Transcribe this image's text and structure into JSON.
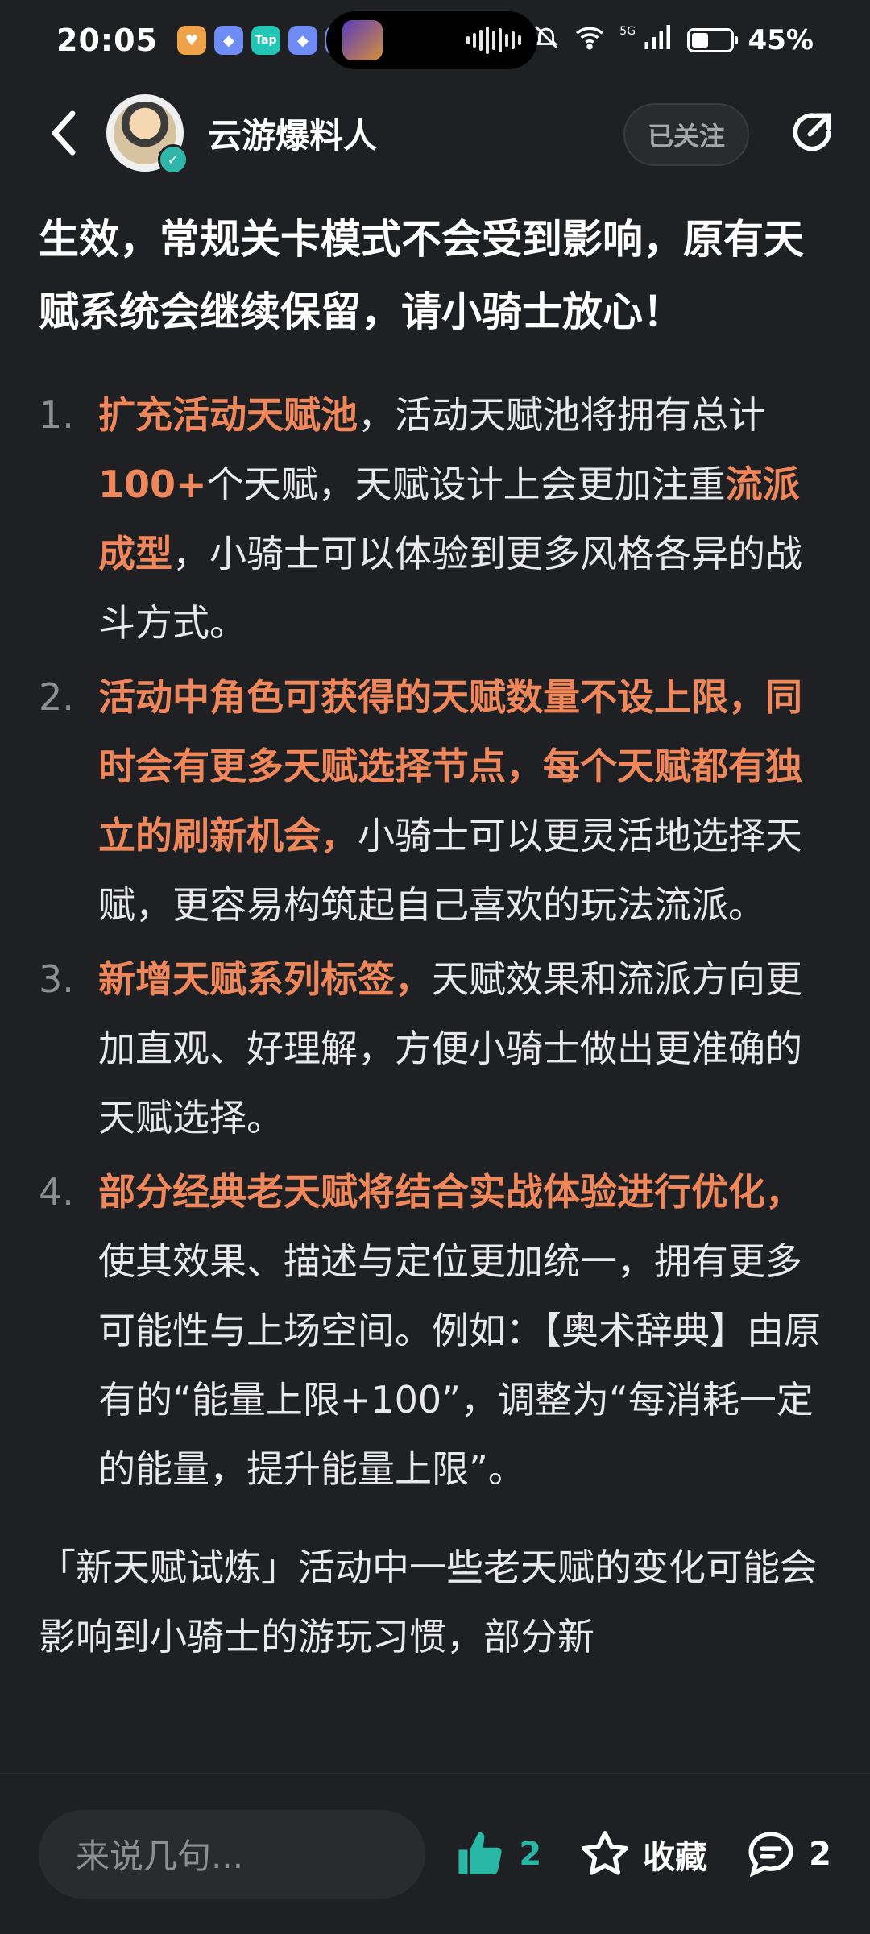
{
  "status_bar": {
    "time": "20:05",
    "battery_percent": "45%",
    "battery_level": 0.45,
    "network": "5G",
    "badge_tap": "Tap"
  },
  "header": {
    "author": "云游爆料人",
    "follow_label": "已关注"
  },
  "article": {
    "lead": "生效，常规关卡模式不会受到影响，原有天赋系统会继续保留，请小骑士放心！",
    "items": [
      {
        "num": "1.",
        "segments": [
          {
            "text": "扩充活动天赋池",
            "hl": true
          },
          {
            "text": "，活动天赋池将拥有总计",
            "hl": false
          },
          {
            "text": "100+",
            "hl": true
          },
          {
            "text": "个天赋，天赋设计上会更加注重",
            "hl": false
          },
          {
            "text": "流派成型",
            "hl": true
          },
          {
            "text": "，小骑士可以体验到更多风格各异的战斗方式。",
            "hl": false
          }
        ]
      },
      {
        "num": "2.",
        "segments": [
          {
            "text": "活动中角色可获得的天赋数量不设上限，同时会有更多天赋选择节点，每个天赋都有独立的刷新机会，",
            "hl": true
          },
          {
            "text": "小骑士可以更灵活地选择天赋，更容易构筑起自己喜欢的玩法流派。",
            "hl": false
          }
        ]
      },
      {
        "num": "3.",
        "segments": [
          {
            "text": "新增天赋系列标签，",
            "hl": true
          },
          {
            "text": "天赋效果和流派方向更加直观、好理解，方便小骑士做出更准确的天赋选择。",
            "hl": false
          }
        ]
      },
      {
        "num": "4.",
        "segments": [
          {
            "text": "部分经典老天赋将结合实战体验进行优化，",
            "hl": true
          },
          {
            "text": "使其效果、描述与定位更加统一，拥有更多可能性与上场空间。例如：【奥术辞典】由原有的“能量上限+100”，调整为“每消耗一定的能量，提升能量上限”。",
            "hl": false
          }
        ]
      }
    ],
    "outro": "「新天赋试炼」活动中一些老天赋的变化可能会影响到小骑士的游玩习惯，部分新"
  },
  "bottom": {
    "comment_placeholder": "来说几句...",
    "like_count": "2",
    "favorite_label": "收藏",
    "comment_count": "2"
  },
  "colors": {
    "background": "#1f2024",
    "highlight": "#f0875a",
    "accent_teal": "#28b7a5"
  },
  "icons": [
    "back-arrow-icon",
    "share-icon",
    "thumbs-up-icon",
    "star-icon",
    "comment-bubble-icon",
    "wifi-icon",
    "signal-icon",
    "mute-bell-icon"
  ]
}
